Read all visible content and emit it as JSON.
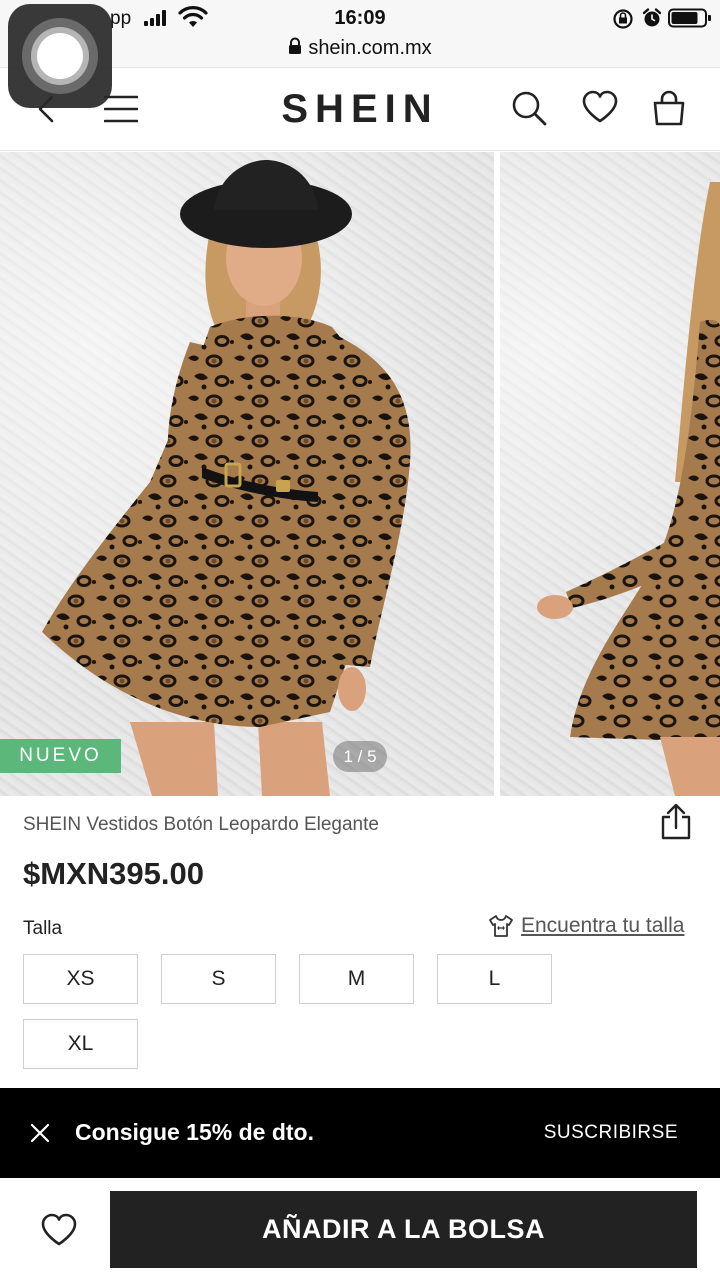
{
  "status_bar": {
    "carrier": "pp",
    "time": "16:09"
  },
  "url_bar": {
    "url": "shein.com.mx"
  },
  "header": {
    "logo": "SHEIN",
    "icons": [
      "back-icon",
      "menu-icon",
      "search-icon",
      "heart-icon",
      "bag-icon"
    ]
  },
  "gallery": {
    "badge": "NUEVO",
    "counter": "1 / 5"
  },
  "product": {
    "title": "SHEIN Vestidos Botón Leopardo Elegante",
    "price": "$MXN395.00"
  },
  "size": {
    "label": "Talla",
    "fit_link": "Encuentra tu talla",
    "options": [
      "XS",
      "S",
      "M",
      "L",
      "XL"
    ]
  },
  "promo": {
    "text": "Consigue 15% de dto.",
    "action": "SUSCRIBIRSE"
  },
  "bottom": {
    "add_to_bag": "AÑADIR A LA BOLSA"
  },
  "colors": {
    "accent_green": "#5cb87a",
    "button_dark": "#222222",
    "promo_bg": "#000000",
    "leopard_base": "#9a6f45"
  }
}
